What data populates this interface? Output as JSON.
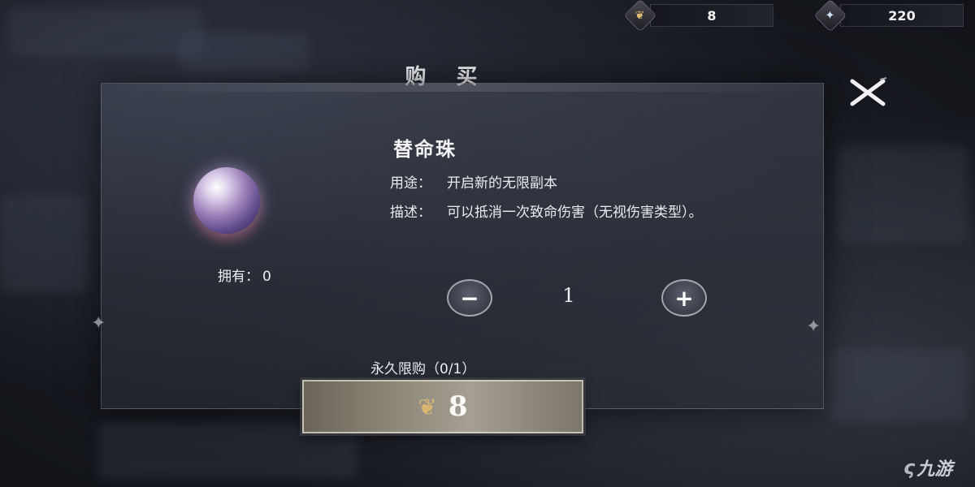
{
  "currency": {
    "gold": {
      "icon": "leaf-icon",
      "amount": "8"
    },
    "crystal": {
      "icon": "crystal-icon",
      "amount": "220"
    }
  },
  "dialog": {
    "title": "购 买",
    "close_icon": "close-icon"
  },
  "item": {
    "name": "替命珠",
    "owned_label": "拥有：",
    "owned_value": "0",
    "usage_label": "用途：",
    "usage_text": "开启新的无限副本",
    "desc_label": "描述：",
    "desc_text": "可以抵消一次致命伤害（无视伤害类型）。"
  },
  "quantity": {
    "minus_label": "−",
    "value": "1",
    "plus_label": "+"
  },
  "purchase": {
    "limit_text": "永久限购（0/1）",
    "price": "8",
    "price_icon": "leaf-icon"
  },
  "watermark": {
    "text": "九游"
  }
}
